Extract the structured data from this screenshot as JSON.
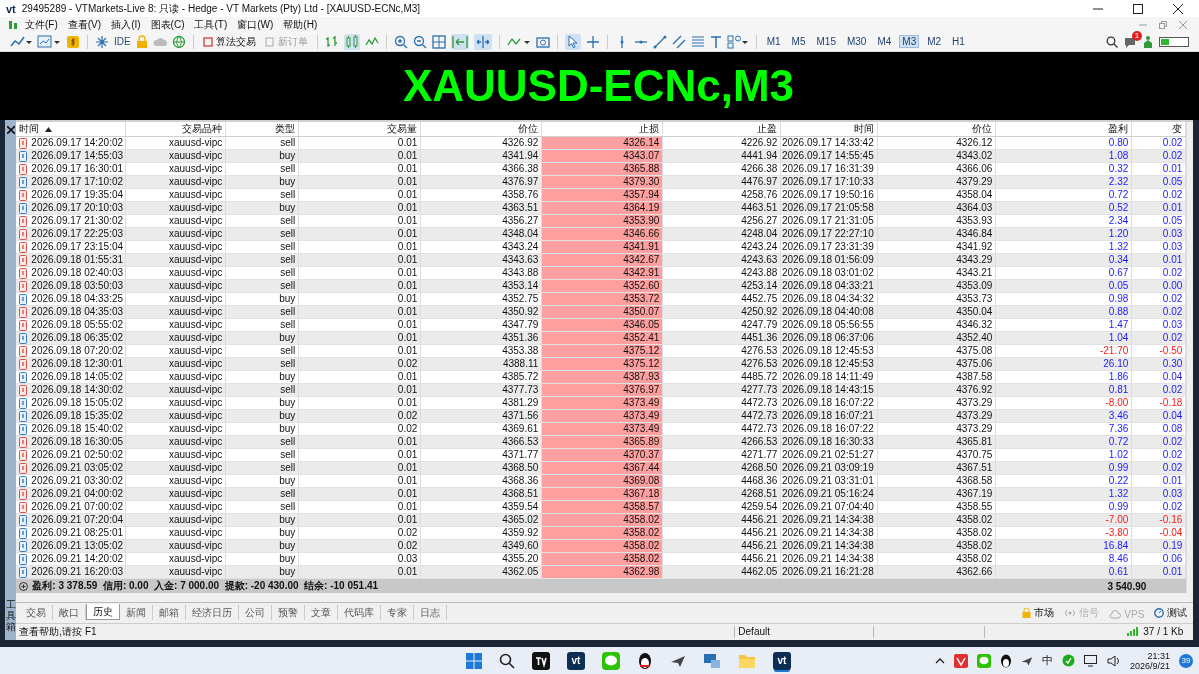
{
  "window": {
    "logo": "vt",
    "title": "29495289 - VTMarkets-Live 8: 只读 - Hedge - VT Markets (Pty) Ltd - [XAUUSD-ECNc,M3]"
  },
  "menu": [
    {
      "label": "文件(F)"
    },
    {
      "label": "查看(V)"
    },
    {
      "label": "插入(I)"
    },
    {
      "label": "图表(C)"
    },
    {
      "label": "工具(T)"
    },
    {
      "label": "窗口(W)"
    },
    {
      "label": "帮助(H)"
    }
  ],
  "toolbar": {
    "ide": "IDE",
    "algo": {
      "label": "算法交易",
      "disabled": false
    },
    "new_order": {
      "label": "新订单",
      "disabled": true
    },
    "timeframes": [
      {
        "label": "M1",
        "selected": false
      },
      {
        "label": "M5",
        "selected": false
      },
      {
        "label": "M15",
        "selected": false
      },
      {
        "label": "M30",
        "selected": false
      },
      {
        "label": "M4",
        "selected": false
      },
      {
        "label": "M3",
        "selected": true
      },
      {
        "label": "M2",
        "selected": false
      },
      {
        "label": "H1",
        "selected": false
      }
    ],
    "notifications": "1"
  },
  "chart": {
    "title": "XAUUSD-ECNc,M3"
  },
  "toolbox": {
    "label": "工具箱"
  },
  "table": {
    "columns": [
      "时间",
      "交易品种",
      "类型",
      "交易量",
      "价位",
      "止损",
      "止盈",
      "时间",
      "价位",
      "盈利",
      "变"
    ],
    "rows": [
      {
        "kind": "sell",
        "time": "2026.09.17 14:20:02",
        "symbol": "xauusd-vipc",
        "type": "sell",
        "volume": "0.01",
        "price": "4326.92",
        "sl": "4326.14",
        "tp": "4226.92",
        "close_time": "2026.09.17 14:33:42",
        "close_price": "4326.12",
        "profit": "0.80",
        "change": "0.02",
        "loss": false
      },
      {
        "kind": "buy",
        "time": "2026.09.17 14:55:03",
        "symbol": "xauusd-vipc",
        "type": "buy",
        "volume": "0.01",
        "price": "4341.94",
        "sl": "4343.07",
        "tp": "4441.94",
        "close_time": "2026.09.17 14:55:45",
        "close_price": "4343.02",
        "profit": "1.08",
        "change": "0.02",
        "loss": false
      },
      {
        "kind": "sell",
        "time": "2026.09.17 16:30:01",
        "symbol": "xauusd-vipc",
        "type": "sell",
        "volume": "0.01",
        "price": "4366.38",
        "sl": "4365.88",
        "tp": "4266.38",
        "close_time": "2026.09.17 16:31:39",
        "close_price": "4366.06",
        "profit": "0.32",
        "change": "0.01",
        "loss": false
      },
      {
        "kind": "buy",
        "time": "2026.09.17 17:10:02",
        "symbol": "xauusd-vipc",
        "type": "buy",
        "volume": "0.01",
        "price": "4376.97",
        "sl": "4379.30",
        "tp": "4476.97",
        "close_time": "2026.09.17 17:10:33",
        "close_price": "4379.29",
        "profit": "2.32",
        "change": "0.05",
        "loss": false
      },
      {
        "kind": "sell",
        "time": "2026.09.17 19:35:04",
        "symbol": "xauusd-vipc",
        "type": "sell",
        "volume": "0.01",
        "price": "4358.76",
        "sl": "4357.94",
        "tp": "4258.76",
        "close_time": "2026.09.17 19:50:16",
        "close_price": "4358.04",
        "profit": "0.72",
        "change": "0.02",
        "loss": false
      },
      {
        "kind": "buy",
        "time": "2026.09.17 20:10:03",
        "symbol": "xauusd-vipc",
        "type": "buy",
        "volume": "0.01",
        "price": "4363.51",
        "sl": "4364.19",
        "tp": "4463.51",
        "close_time": "2026.09.17 21:05:58",
        "close_price": "4364.03",
        "profit": "0.52",
        "change": "0.01",
        "loss": false
      },
      {
        "kind": "sell",
        "time": "2026.09.17 21:30:02",
        "symbol": "xauusd-vipc",
        "type": "sell",
        "volume": "0.01",
        "price": "4356.27",
        "sl": "4353.90",
        "tp": "4256.27",
        "close_time": "2026.09.17 21:31:05",
        "close_price": "4353.93",
        "profit": "2.34",
        "change": "0.05",
        "loss": false
      },
      {
        "kind": "sell",
        "time": "2026.09.17 22:25:03",
        "symbol": "xauusd-vipc",
        "type": "sell",
        "volume": "0.01",
        "price": "4348.04",
        "sl": "4346.66",
        "tp": "4248.04",
        "close_time": "2026.09.17 22:27:10",
        "close_price": "4346.84",
        "profit": "1.20",
        "change": "0.03",
        "loss": false
      },
      {
        "kind": "sell",
        "time": "2026.09.17 23:15:04",
        "symbol": "xauusd-vipc",
        "type": "sell",
        "volume": "0.01",
        "price": "4343.24",
        "sl": "4341.91",
        "tp": "4243.24",
        "close_time": "2026.09.17 23:31:39",
        "close_price": "4341.92",
        "profit": "1.32",
        "change": "0.03",
        "loss": false
      },
      {
        "kind": "sell",
        "time": "2026.09.18 01:55:31",
        "symbol": "xauusd-vipc",
        "type": "sell",
        "volume": "0.01",
        "price": "4343.63",
        "sl": "4342.67",
        "tp": "4243.63",
        "close_time": "2026.09.18 01:56:09",
        "close_price": "4343.29",
        "profit": "0.34",
        "change": "0.01",
        "loss": false
      },
      {
        "kind": "sell",
        "time": "2026.09.18 02:40:03",
        "symbol": "xauusd-vipc",
        "type": "sell",
        "volume": "0.01",
        "price": "4343.88",
        "sl": "4342.91",
        "tp": "4243.88",
        "close_time": "2026.09.18 03:01:02",
        "close_price": "4343.21",
        "profit": "0.67",
        "change": "0.02",
        "loss": false
      },
      {
        "kind": "sell",
        "time": "2026.09.18 03:50:03",
        "symbol": "xauusd-vipc",
        "type": "sell",
        "volume": "0.01",
        "price": "4353.14",
        "sl": "4352.60",
        "tp": "4253.14",
        "close_time": "2026.09.18 04:33:21",
        "close_price": "4353.09",
        "profit": "0.05",
        "change": "0.00",
        "loss": false
      },
      {
        "kind": "buy",
        "time": "2026.09.18 04:33:25",
        "symbol": "xauusd-vipc",
        "type": "buy",
        "volume": "0.01",
        "price": "4352.75",
        "sl": "4353.72",
        "tp": "4452.75",
        "close_time": "2026.09.18 04:34:32",
        "close_price": "4353.73",
        "profit": "0.98",
        "change": "0.02",
        "loss": false
      },
      {
        "kind": "sell",
        "time": "2026.09.18 04:35:03",
        "symbol": "xauusd-vipc",
        "type": "sell",
        "volume": "0.01",
        "price": "4350.92",
        "sl": "4350.07",
        "tp": "4250.92",
        "close_time": "2026.09.18 04:40:08",
        "close_price": "4350.04",
        "profit": "0.88",
        "change": "0.02",
        "loss": false
      },
      {
        "kind": "sell",
        "time": "2026.09.18 05:55:02",
        "symbol": "xauusd-vipc",
        "type": "sell",
        "volume": "0.01",
        "price": "4347.79",
        "sl": "4346.05",
        "tp": "4247.79",
        "close_time": "2026.09.18 05:56:55",
        "close_price": "4346.32",
        "profit": "1.47",
        "change": "0.03",
        "loss": false
      },
      {
        "kind": "buy",
        "time": "2026.09.18 06:35:02",
        "symbol": "xauusd-vipc",
        "type": "buy",
        "volume": "0.01",
        "price": "4351.36",
        "sl": "4352.41",
        "tp": "4451.36",
        "close_time": "2026.09.18 06:37:06",
        "close_price": "4352.40",
        "profit": "1.04",
        "change": "0.02",
        "loss": false
      },
      {
        "kind": "sell",
        "time": "2026.09.18 07:20:02",
        "symbol": "xauusd-vipc",
        "type": "sell",
        "volume": "0.01",
        "price": "4353.38",
        "sl": "4375.12",
        "tp": "4276.53",
        "close_time": "2026.09.18 12:45:53",
        "close_price": "4375.08",
        "profit": "-21.70",
        "change": "-0.50",
        "loss": true
      },
      {
        "kind": "sell",
        "time": "2026.09.18 12:30:01",
        "symbol": "xauusd-vipc",
        "type": "sell",
        "volume": "0.02",
        "price": "4388.11",
        "sl": "4375.12",
        "tp": "4276.53",
        "close_time": "2026.09.18 12:45:53",
        "close_price": "4375.06",
        "profit": "26.10",
        "change": "0.30",
        "loss": false
      },
      {
        "kind": "buy",
        "time": "2026.09.18 14:05:02",
        "symbol": "xauusd-vipc",
        "type": "buy",
        "volume": "0.01",
        "price": "4385.72",
        "sl": "4387.93",
        "tp": "4485.72",
        "close_time": "2026.09.18 14:11:49",
        "close_price": "4387.58",
        "profit": "1.86",
        "change": "0.04",
        "loss": false
      },
      {
        "kind": "sell",
        "time": "2026.09.18 14:30:02",
        "symbol": "xauusd-vipc",
        "type": "sell",
        "volume": "0.01",
        "price": "4377.73",
        "sl": "4376.97",
        "tp": "4277.73",
        "close_time": "2026.09.18 14:43:15",
        "close_price": "4376.92",
        "profit": "0.81",
        "change": "0.02",
        "loss": false
      },
      {
        "kind": "buy",
        "time": "2026.09.18 15:05:02",
        "symbol": "xauusd-vipc",
        "type": "buy",
        "volume": "0.01",
        "price": "4381.29",
        "sl": "4373.49",
        "tp": "4472.73",
        "close_time": "2026.09.18 16:07:22",
        "close_price": "4373.29",
        "profit": "-8.00",
        "change": "-0.18",
        "loss": true
      },
      {
        "kind": "buy",
        "time": "2026.09.18 15:35:02",
        "symbol": "xauusd-vipc",
        "type": "buy",
        "volume": "0.02",
        "price": "4371.56",
        "sl": "4373.49",
        "tp": "4472.73",
        "close_time": "2026.09.18 16:07:21",
        "close_price": "4373.29",
        "profit": "3.46",
        "change": "0.04",
        "loss": false
      },
      {
        "kind": "buy",
        "time": "2026.09.18 15:40:02",
        "symbol": "xauusd-vipc",
        "type": "buy",
        "volume": "0.02",
        "price": "4369.61",
        "sl": "4373.49",
        "tp": "4472.73",
        "close_time": "2026.09.18 16:07:22",
        "close_price": "4373.29",
        "profit": "7.36",
        "change": "0.08",
        "loss": false
      },
      {
        "kind": "sell",
        "time": "2026.09.18 16:30:05",
        "symbol": "xauusd-vipc",
        "type": "sell",
        "volume": "0.01",
        "price": "4366.53",
        "sl": "4365.89",
        "tp": "4266.53",
        "close_time": "2026.09.18 16:30:33",
        "close_price": "4365.81",
        "profit": "0.72",
        "change": "0.02",
        "loss": false
      },
      {
        "kind": "sell",
        "time": "2026.09.21 02:50:02",
        "symbol": "xauusd-vipc",
        "type": "sell",
        "volume": "0.01",
        "price": "4371.77",
        "sl": "4370.37",
        "tp": "4271.77",
        "close_time": "2026.09.21 02:51:27",
        "close_price": "4370.75",
        "profit": "1.02",
        "change": "0.02",
        "loss": false
      },
      {
        "kind": "sell",
        "time": "2026.09.21 03:05:02",
        "symbol": "xauusd-vipc",
        "type": "sell",
        "volume": "0.01",
        "price": "4368.50",
        "sl": "4367.44",
        "tp": "4268.50",
        "close_time": "2026.09.21 03:09:19",
        "close_price": "4367.51",
        "profit": "0.99",
        "change": "0.02",
        "loss": false
      },
      {
        "kind": "buy",
        "time": "2026.09.21 03:30:02",
        "symbol": "xauusd-vipc",
        "type": "buy",
        "volume": "0.01",
        "price": "4368.36",
        "sl": "4369.08",
        "tp": "4468.36",
        "close_time": "2026.09.21 03:31:01",
        "close_price": "4368.58",
        "profit": "0.22",
        "change": "0.01",
        "loss": false
      },
      {
        "kind": "sell",
        "time": "2026.09.21 04:00:02",
        "symbol": "xauusd-vipc",
        "type": "sell",
        "volume": "0.01",
        "price": "4368.51",
        "sl": "4367.18",
        "tp": "4268.51",
        "close_time": "2026.09.21 05:16:24",
        "close_price": "4367.19",
        "profit": "1.32",
        "change": "0.03",
        "loss": false
      },
      {
        "kind": "sell",
        "time": "2026.09.21 07:00:02",
        "symbol": "xauusd-vipc",
        "type": "sell",
        "volume": "0.01",
        "price": "4359.54",
        "sl": "4358.57",
        "tp": "4259.54",
        "close_time": "2026.09.21 07:04:40",
        "close_price": "4358.55",
        "profit": "0.99",
        "change": "0.02",
        "loss": false
      },
      {
        "kind": "buy",
        "time": "2026.09.21 07:20:04",
        "symbol": "xauusd-vipc",
        "type": "buy",
        "volume": "0.01",
        "price": "4365.02",
        "sl": "4358.02",
        "tp": "4456.21",
        "close_time": "2026.09.21 14:34:38",
        "close_price": "4358.02",
        "profit": "-7.00",
        "change": "-0.16",
        "loss": true
      },
      {
        "kind": "buy",
        "time": "2026.09.21 08:25:01",
        "symbol": "xauusd-vipc",
        "type": "buy",
        "volume": "0.02",
        "price": "4359.92",
        "sl": "4358.02",
        "tp": "4456.21",
        "close_time": "2026.09.21 14:34:38",
        "close_price": "4358.02",
        "profit": "-3.80",
        "change": "-0.04",
        "loss": true
      },
      {
        "kind": "buy",
        "time": "2026.09.21 13:05:02",
        "symbol": "xauusd-vipc",
        "type": "buy",
        "volume": "0.02",
        "price": "4349.60",
        "sl": "4358.02",
        "tp": "4456.21",
        "close_time": "2026.09.21 14:34:38",
        "close_price": "4358.02",
        "profit": "16.84",
        "change": "0.19",
        "loss": false
      },
      {
        "kind": "buy",
        "time": "2026.09.21 14:20:02",
        "symbol": "xauusd-vipc",
        "type": "buy",
        "volume": "0.03",
        "price": "4355.20",
        "sl": "4358.02",
        "tp": "4456.21",
        "close_time": "2026.09.21 14:34:38",
        "close_price": "4358.02",
        "profit": "8.46",
        "change": "0.06",
        "loss": false
      },
      {
        "kind": "buy",
        "time": "2026.09.21 16:20:03",
        "symbol": "xauusd-vipc",
        "type": "buy",
        "volume": "0.01",
        "price": "4362.05",
        "sl": "4362.98",
        "tp": "4462.05",
        "close_time": "2026.09.21 16:21:28",
        "close_price": "4362.66",
        "profit": "0.61",
        "change": "0.01",
        "loss": false
      }
    ],
    "summary": {
      "text": "盈利: 3 378.59  信用: 0.00  入金: 7 000.00  提款: -20 430.00  结余: -10 051.41",
      "total": "3 540.90"
    }
  },
  "tabs": [
    {
      "label": "交易",
      "selected": false
    },
    {
      "label": "敞口",
      "selected": false
    },
    {
      "label": "历史",
      "selected": true
    },
    {
      "label": "新闻",
      "selected": false
    },
    {
      "label": "邮箱",
      "selected": false
    },
    {
      "label": "经济日历",
      "selected": false
    },
    {
      "label": "公司",
      "selected": false
    },
    {
      "label": "预警",
      "selected": false
    },
    {
      "label": "文章",
      "selected": false
    },
    {
      "label": "代码库",
      "selected": false
    },
    {
      "label": "专家",
      "selected": false
    },
    {
      "label": "日志",
      "selected": false
    }
  ],
  "services": [
    {
      "kind": "market",
      "label": "市场",
      "disabled": false
    },
    {
      "kind": "signals",
      "label": "信号",
      "disabled": true
    },
    {
      "kind": "vps",
      "label": "VPS",
      "disabled": true
    },
    {
      "kind": "tester",
      "label": "测试",
      "disabled": false
    }
  ],
  "status_bar": {
    "help": "查看帮助,请按 F1",
    "profile": "Default",
    "traffic": "37 / 1 Kb"
  },
  "taskbar": {
    "app_logos": [
      "vt",
      "vt"
    ],
    "input_method": "中",
    "time": "21:31",
    "date": "2026/9/21",
    "notifications": "39"
  }
}
